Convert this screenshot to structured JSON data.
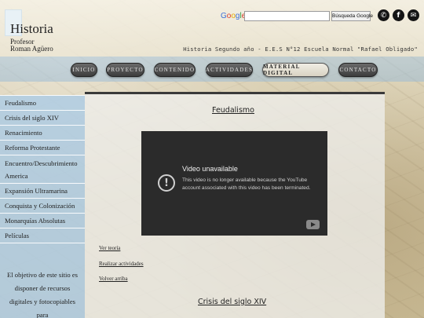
{
  "header": {
    "title": "Historia",
    "subtitle_line1": "Profesor",
    "subtitle_line2": "Roman Agüero",
    "school_line": "Historia Segundo año - E.E.S N°12 Escuela Normal \"Rafael Obligado\""
  },
  "search": {
    "google_letters": [
      "G",
      "o",
      "o",
      "g",
      "l",
      "e"
    ],
    "placeholder": "",
    "button_label": "Búsqueda Google"
  },
  "social": {
    "whatsapp_icon": "✆",
    "facebook_icon": "f",
    "mail_icon": "✉"
  },
  "nav": {
    "items": [
      "INICIO",
      "PROYECTO",
      "CONTENIDO",
      "ACTIVIDADES",
      "MATERIAL DIGITAL",
      "CONTACTO"
    ],
    "active": "MATERIAL DIGITAL"
  },
  "sidebar": {
    "items": [
      "Feudalismo",
      "Crisis del siglo XIV",
      "Renacimiento",
      "Reforma Protestante",
      "Encuentro/Descubrimiento America",
      "Expansión Ultramarina",
      "Conquista y Colonización",
      "Monarquías Absolutas",
      "Películas"
    ],
    "text": "El objetivo de este sitio es disponer de recursos digitales y fotocopiables para"
  },
  "main": {
    "section1_title": "Feudalismo",
    "video": {
      "title": "Video unavailable",
      "message": "This video is no longer available because the YouTube account associated with this video has been terminated.",
      "alert_icon": "!"
    },
    "links": [
      "Ver teoría",
      "Realizar actividades",
      "Volver arriba"
    ],
    "section2_title": "Crisis del siglo XIV"
  },
  "colors": {
    "sidebar_bg": "#afcde4",
    "nav_button": "#4a4a4a",
    "video_bg": "#2b2b2b"
  }
}
